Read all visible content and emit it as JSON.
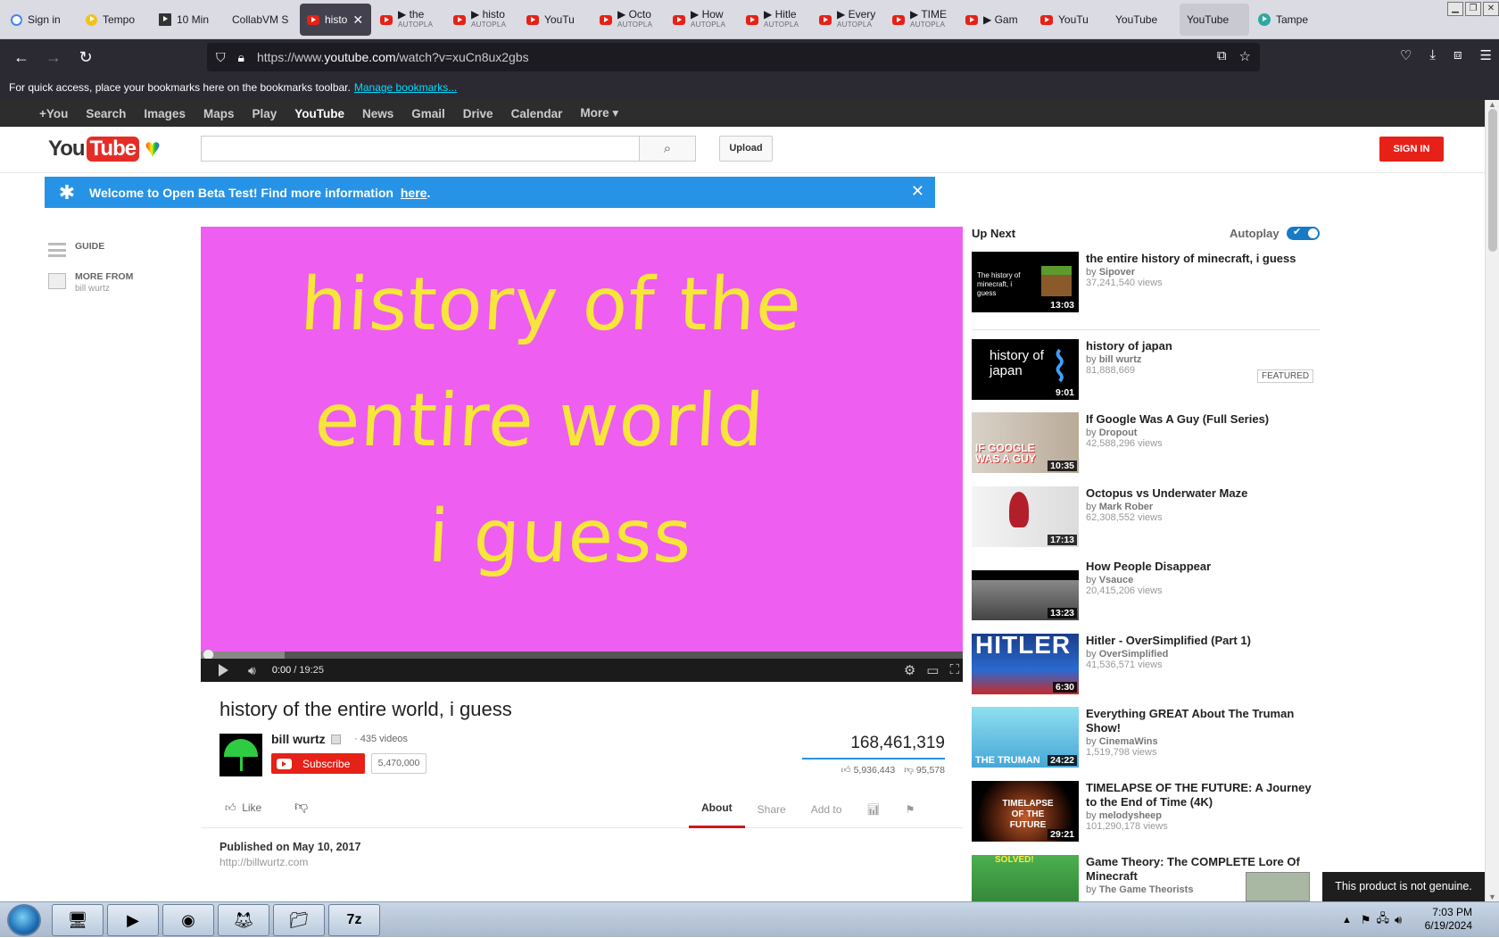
{
  "browser": {
    "tabs": [
      {
        "label": "Sign in",
        "icon": "google-icon",
        "sub": ""
      },
      {
        "label": "Tempo",
        "icon": "tempo-icon",
        "sub": ""
      },
      {
        "label": "10 Min",
        "icon": "ten-min-icon",
        "sub": ""
      },
      {
        "label": "CollabVM S",
        "icon": "",
        "sub": ""
      },
      {
        "label": "histo",
        "icon": "youtube-icon",
        "sub": "",
        "active": true
      },
      {
        "label": "▶ the",
        "icon": "youtube-icon",
        "sub": "AUTOPLA"
      },
      {
        "label": "▶ histo",
        "icon": "youtube-icon",
        "sub": "AUTOPLA"
      },
      {
        "label": "YouTu",
        "icon": "youtube-icon",
        "sub": ""
      },
      {
        "label": "▶ Octo",
        "icon": "youtube-icon",
        "sub": "AUTOPLA"
      },
      {
        "label": "▶ How",
        "icon": "youtube-icon",
        "sub": "AUTOPLA"
      },
      {
        "label": "▶ Hitle",
        "icon": "youtube-icon",
        "sub": "AUTOPLA"
      },
      {
        "label": "▶ Every",
        "icon": "youtube-icon",
        "sub": "AUTOPLA"
      },
      {
        "label": "▶ TIME",
        "icon": "youtube-icon",
        "sub": "AUTOPLA"
      },
      {
        "label": "▶ Gam",
        "icon": "youtube-icon",
        "sub": ""
      },
      {
        "label": "YouTu",
        "icon": "youtube-icon",
        "sub": ""
      },
      {
        "label": "YouTube",
        "icon": "",
        "sub": ""
      },
      {
        "label": "YouTube",
        "icon": "",
        "sub": "",
        "hover": true
      },
      {
        "label": "Tampe",
        "icon": "tampermonkey-icon",
        "sub": ""
      }
    ],
    "url_prefix": "https://www.",
    "url_host": "youtube.com",
    "url_path": "/watch?v=xuCn8ux2gbs",
    "bookmarks_text": "For quick access, place your bookmarks here on the bookmarks toolbar.",
    "bookmarks_link": "Manage bookmarks..."
  },
  "gbar": {
    "items": [
      "+You",
      "Search",
      "Images",
      "Maps",
      "Play",
      "YouTube",
      "News",
      "Gmail",
      "Drive",
      "Calendar",
      "More ▾"
    ],
    "selected": "YouTube"
  },
  "header": {
    "logo_you": "You",
    "logo_tube": "Tube",
    "search_placeholder": "",
    "upload_label": "Upload",
    "signin_label": "SIGN IN"
  },
  "banner": {
    "text": "Welcome to Open Beta Test! Find more information",
    "link": "here",
    "end": "."
  },
  "guide": {
    "guide_label": "GUIDE",
    "more_from_label": "MORE FROM",
    "more_from_channel": "bill wurtz"
  },
  "player": {
    "lines": [
      "history of the",
      "entire world",
      "i guess"
    ],
    "time_current": "0:00",
    "time_total": " / 19:25",
    "progress_buffered": 0.11
  },
  "video": {
    "title": "history of the entire world, i guess",
    "channel": "bill wurtz",
    "video_count": "· 435 videos",
    "subscribe_label": "Subscribe",
    "subscriber_count": "5,470,000",
    "views": "168,461,319",
    "likes": "5,936,443",
    "dislikes": "95,578",
    "like_label": "Like",
    "tabs": [
      "About",
      "Share",
      "Add to"
    ],
    "published": "Published on May 10, 2017",
    "website": "http://billwurtz.com"
  },
  "upnext": {
    "header": "Up Next",
    "autoplay_label": "Autoplay",
    "featured_label": "FEATURED",
    "items": [
      {
        "title": "the entire history of minecraft, i guess",
        "by": "Sipover",
        "views": "37,241,540 views",
        "duration": "13:03",
        "thumb_text": "The history of minecraft, i guess"
      },
      {
        "title": "history of japan",
        "by": "bill wurtz",
        "views": "81,888,669",
        "duration": "9:01",
        "thumb_text": "history of japan",
        "featured": true
      },
      {
        "title": "If Google Was A Guy (Full Series)",
        "by": "Dropout",
        "views": "42,588,296 views",
        "duration": "10:35",
        "thumb_text": "IF GOOGLE WAS A GUY"
      },
      {
        "title": "Octopus vs Underwater Maze",
        "by": "Mark Rober",
        "views": "62,308,552 views",
        "duration": "17:13",
        "thumb_text": ""
      },
      {
        "title": "How People Disappear",
        "by": "Vsauce",
        "views": "20,415,206 views",
        "duration": "13:23",
        "thumb_text": ""
      },
      {
        "title": "Hitler - OverSimplified (Part 1)",
        "by": "OverSimplified",
        "views": "41,536,571 views",
        "duration": "6:30",
        "thumb_text": "HITLER"
      },
      {
        "title": "Everything GREAT About The Truman Show!",
        "by": "CinemaWins",
        "views": "1,519,798 views",
        "duration": "24:22",
        "thumb_text": "THE TRUMAN"
      },
      {
        "title": "TIMELAPSE OF THE FUTURE: A Journey to the End of Time (4K)",
        "by": "melodysheep",
        "views": "101,290,178 views",
        "duration": "29:21",
        "thumb_text": "TIMELAPSE OF THE FUTURE"
      },
      {
        "title": "Game Theory: The COMPLETE Lore Of Minecraft",
        "by": "The Game Theorists",
        "views": "",
        "duration": "",
        "thumb_text": "SOLVED!"
      }
    ]
  },
  "system": {
    "genuine_notice": "This product is not genuine.",
    "clock_time": "7:03 PM",
    "clock_date": "6/19/2024"
  }
}
